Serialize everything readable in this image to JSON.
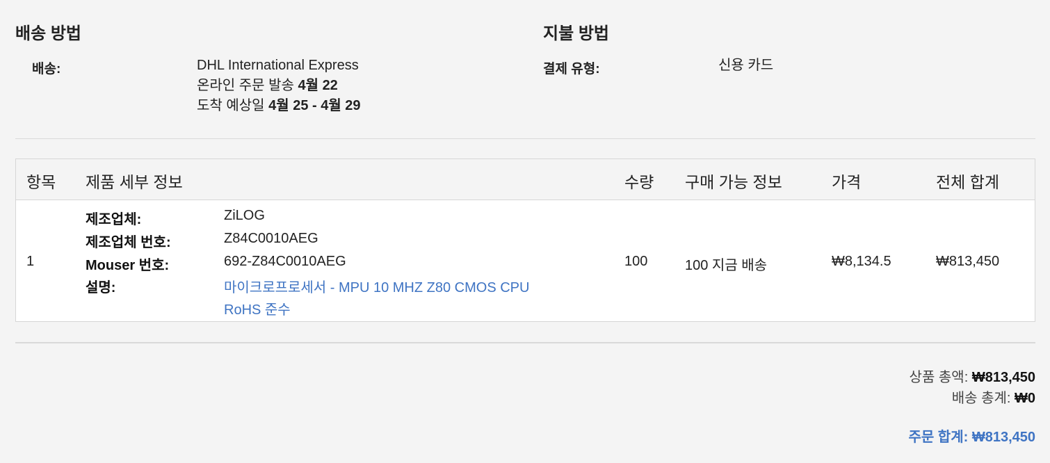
{
  "shipping": {
    "title": "배송 방법",
    "label": "배송:",
    "carrier": "DHL International Express",
    "ship_prefix": "온라인 주문 발송 ",
    "ship_date": "4월 22",
    "arrival_prefix": "도착 예상일 ",
    "arrival_range": "4월 25 - 4월 29"
  },
  "payment": {
    "title": "지불 방법",
    "label": "결제 유형:",
    "value": "신용 카드"
  },
  "table": {
    "headers": {
      "item": "항목",
      "details": "제품 세부 정보",
      "qty": "수량",
      "availability": "구매 가능 정보",
      "price": "가격",
      "total": "전체 합계"
    },
    "row": {
      "item_no": "1",
      "manufacturer_label": "제조업체:",
      "manufacturer": "ZiLOG",
      "mfr_part_label": "제조업체 번호:",
      "mfr_part": "Z84C0010AEG",
      "mouser_part_label": "Mouser 번호:",
      "mouser_part": "692-Z84C0010AEG",
      "description_label": "설명:",
      "description_line1": "마이크로프로세서 - MPU 10 MHZ Z80 CMOS CPU",
      "description_line2": "RoHS 준수",
      "qty": "100",
      "availability": "100 지금 배송",
      "price": "₩8,134.5",
      "total": "₩813,450"
    }
  },
  "summary": {
    "subtotal_label": "상품 총액: ",
    "subtotal": "₩813,450",
    "shipping_label": "배송 총계: ",
    "shipping": "₩0",
    "order_total_label": "주문 합계: ",
    "order_total": "₩813,450"
  },
  "colors": {
    "link": "#3f74c3",
    "background": "#f4f4f4"
  }
}
